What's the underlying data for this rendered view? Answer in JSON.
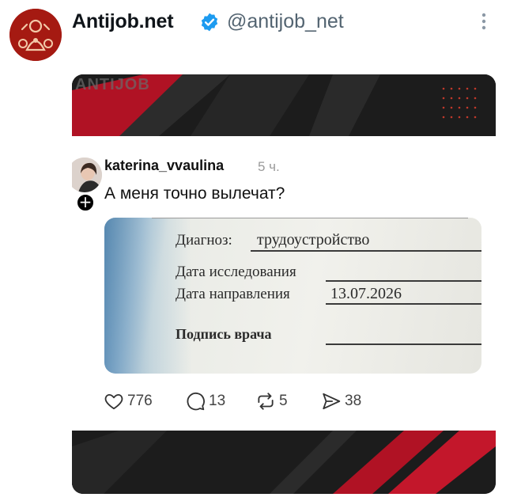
{
  "tweet": {
    "author_name": "Antijob.net",
    "author_handle": "@antijob_net",
    "verified_icon": "verified-badge-icon",
    "more_icon": "more-options-icon"
  },
  "media": {
    "watermark": "ANTIJOB",
    "post": {
      "username": "katerina_vvaulina",
      "time": "5 ч.",
      "text": "А меня точно вылечат?",
      "follow_symbol": "+",
      "document": {
        "diagnosis_label": "Диагноз:",
        "diagnosis_value": "трудоустройство",
        "exam_date_label": "Дата исследования",
        "referral_date_label": "Дата направления",
        "referral_date_value": "13.07.2026",
        "signature_label": "Подпись врача"
      },
      "actions": {
        "likes": "776",
        "comments": "13",
        "reposts": "5",
        "shares": "38"
      }
    }
  },
  "colors": {
    "accent_red": "#c8102e",
    "verified_blue": "#1d9bf0",
    "dark_bg": "#1a1a1a"
  }
}
